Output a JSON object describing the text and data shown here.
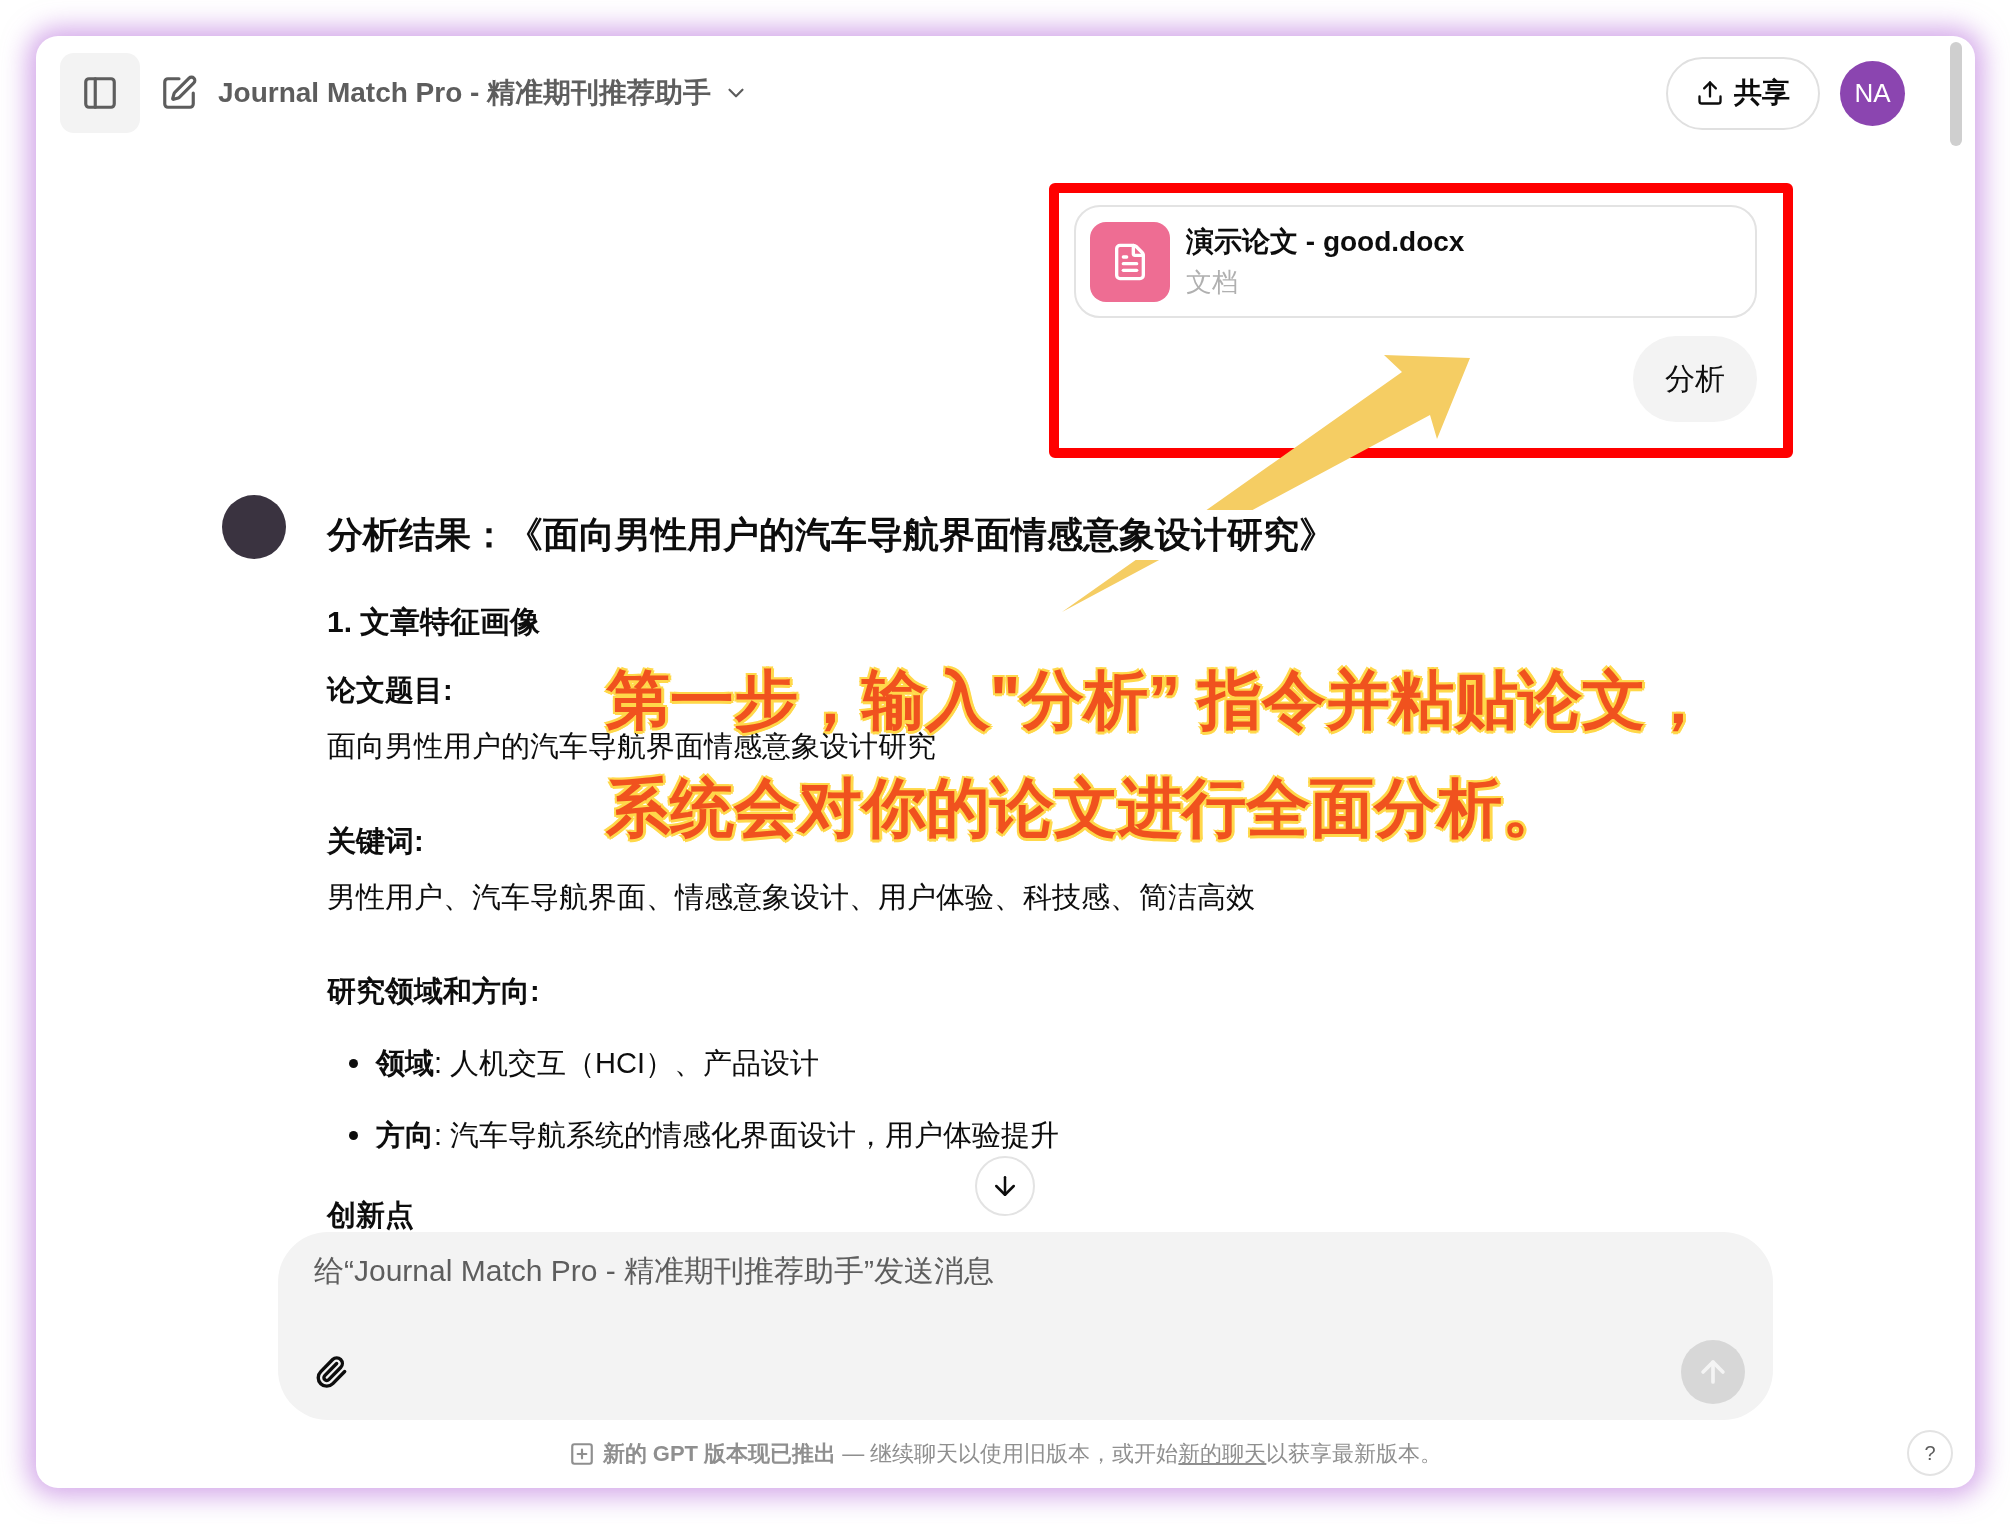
{
  "header": {
    "title": "Journal Match Pro - 精准期刊推荐助手",
    "share_label": "共享",
    "user_initials": "NA"
  },
  "user_message": {
    "attachment": {
      "name": "演示论文 - good.docx",
      "type": "文档"
    },
    "text": "分析"
  },
  "assistant_message": {
    "heading": "分析结果：《面向男性用户的汽车导航界面情感意象设计研究》",
    "section_title": "1. 文章特征画像",
    "blocks": [
      {
        "kind": "field",
        "label": "论文题目:",
        "value": "面向男性用户的汽车导航界面情感意象设计研究"
      },
      {
        "kind": "field",
        "label": "关键词:",
        "value": "男性用户、汽车导航界面、情感意象设计、用户体验、科技感、简洁高效"
      },
      {
        "kind": "list",
        "label": "研究领域和方向:",
        "items": [
          "**领域**: 人机交互（HCI）、产品设计",
          "**方向**: 汽车导航系统的情感化界面设计，用户体验提升"
        ]
      },
      {
        "kind": "label",
        "label": "创新点"
      }
    ]
  },
  "composer": {
    "placeholder": "给“Journal Match Pro - 精准期刊推荐助手”发送消息"
  },
  "footer": {
    "notice": "**新的 GPT 版本现已推出** — 继续聊天以使用旧版本，或开始",
    "link": "新的聊天",
    "notice_end": "以获享最新版本。",
    "help": "?"
  },
  "annotation": {
    "caption_lines": [
      "第一步，输入\"分析” 指令并粘贴论文，",
      "系统会对你的论文进行全面分析。"
    ]
  }
}
